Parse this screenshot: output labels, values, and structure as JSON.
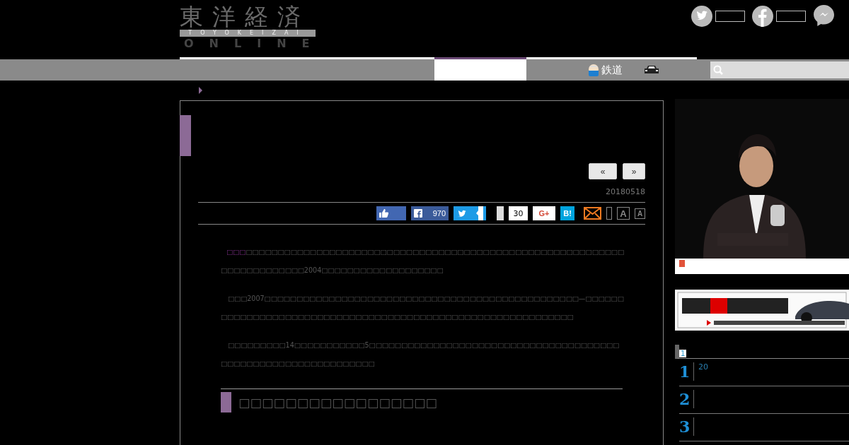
{
  "header": {
    "logo": {
      "kanji": "東洋経済",
      "band": "TOYOKEIZAI",
      "sub": "ONLINE"
    },
    "social": [
      {
        "kind": "twitter"
      },
      {
        "kind": "facebook"
      },
      {
        "kind": "messenger"
      }
    ]
  },
  "nav": {
    "items": [
      {
        "kind": "tab",
        "selected": true
      },
      {
        "kind": "railway",
        "label": "鉄道",
        "selected": false
      },
      {
        "kind": "car",
        "selected": false
      }
    ],
    "search": {
      "kind": "field"
    }
  },
  "article": {
    "pager": [
      "«",
      "»"
    ],
    "date": "20180518",
    "share": [
      {
        "kind": "like"
      },
      {
        "kind": "facebook",
        "count": "970"
      },
      {
        "kind": "twitter"
      },
      {
        "kind": "counter",
        "count": "30"
      },
      {
        "kind": "gplus",
        "label": "G+"
      },
      {
        "kind": "hatena",
        "label": "B!"
      },
      {
        "kind": "mail"
      },
      {
        "kind": "bar"
      },
      {
        "kind": "font-large",
        "label": "A"
      },
      {
        "kind": "font-small",
        "label": "A"
      }
    ],
    "paragraphs": [
      {
        "link": "□□□",
        "text": "□□□□□□□□□□□□□□□□□□□□□□□□□□□□□□□□□□□□□□□□□□□□□□□□□□□□□□□□□□□□□□□□□□□□□□□□2004□□□□□□□□□□□□□□□□□□□"
      },
      {
        "text": "　□□□2007□□□□□□□□□□□□□□□□□□□□□□□□□□□□□□□□□□□□□□□□□□□□□□□□□—□□□□□□□□□□□□□□□□□□□□□□□□□□□□□□□□□□□□□□□□□□□□□□□□□□□□□□□□□□□□□"
      },
      {
        "text": "　□□□□□□□□□14□□□□□□□□□□□5□□□□□□□□□□□□□□□□□□□□□□□□□□□□□□□□□□□□□□□□□□□□□□□□□□□□□□□□□□□□□□□"
      }
    ],
    "heading": "□□□□□□□□□□□□□□□□□"
  },
  "sidebar": {
    "ranking": {
      "page": "1",
      "rows": [
        {
          "rank": "1",
          "text": "20"
        },
        {
          "rank": "2"
        },
        {
          "rank": "3"
        }
      ]
    }
  }
}
